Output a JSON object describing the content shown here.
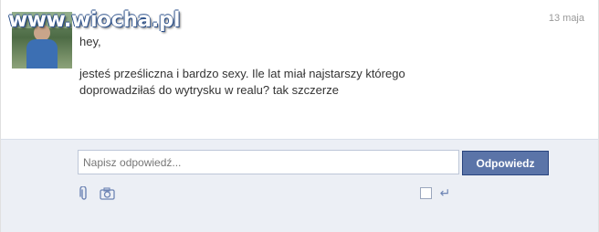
{
  "watermark": "www.wiocha.pl",
  "message": {
    "date": "13 maja",
    "greeting": "hey,",
    "body_line1": "jesteś prześliczna i bardzo sexy. Ile lat miał najstarszy którego",
    "body_line2": "doprowadziłaś do wytrysku w realu? tak szczerze"
  },
  "reply": {
    "placeholder": "Napisz odpowiedź...",
    "button_label": "Odpowiedz",
    "enter_to_send_checked": false
  },
  "icons": {
    "attach": "paperclip-icon",
    "camera": "camera-icon",
    "enter": "enter-icon"
  },
  "colors": {
    "button_bg": "#5b74a8",
    "reply_area_bg": "#eceff5",
    "watermark_outline": "#2a4f8a"
  }
}
